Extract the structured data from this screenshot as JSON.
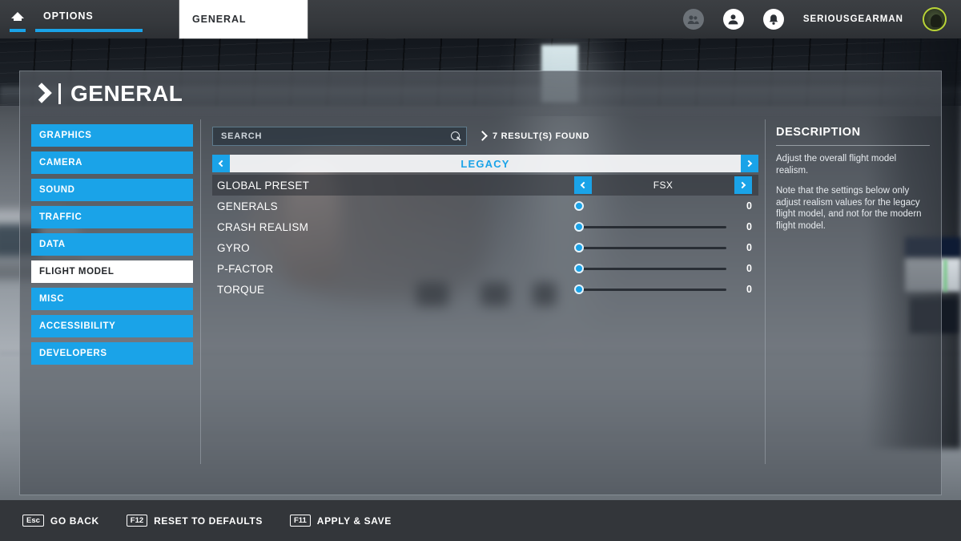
{
  "topbar": {
    "home_icon": "home-icon",
    "options_tab": "OPTIONS",
    "general_tab": "GENERAL",
    "friends_icon": "friends-icon",
    "profile_icon": "profile-icon",
    "notifications_icon": "bell-icon",
    "username": "SERIOUSGEARMAN",
    "avatar": "user-avatar"
  },
  "dialog": {
    "title": "GENERAL",
    "title_icon": "chevron-right-icon"
  },
  "sidebar": {
    "items": [
      {
        "label": "GRAPHICS",
        "active": false
      },
      {
        "label": "CAMERA",
        "active": false
      },
      {
        "label": "SOUND",
        "active": false
      },
      {
        "label": "TRAFFIC",
        "active": false
      },
      {
        "label": "DATA",
        "active": false
      },
      {
        "label": "FLIGHT MODEL",
        "active": true
      },
      {
        "label": "MISC",
        "active": false
      },
      {
        "label": "ACCESSIBILITY",
        "active": false
      },
      {
        "label": "DEVELOPERS",
        "active": false
      }
    ]
  },
  "search": {
    "placeholder": "SEARCH",
    "value": "",
    "icon": "search-icon",
    "results_text": "7 RESULT(S) FOUND",
    "results_chevron": "chevron-right-icon"
  },
  "category": {
    "title": "LEGACY",
    "prev_icon": "chevron-left-icon",
    "next_icon": "chevron-right-icon"
  },
  "settings": [
    {
      "label": "GLOBAL PRESET",
      "type": "dropdown",
      "value": "FSX",
      "banded": true
    },
    {
      "label": "GENERALS",
      "type": "slider",
      "value": "0",
      "percent": 0,
      "hover": true
    },
    {
      "label": "CRASH REALISM",
      "type": "slider",
      "value": "0",
      "percent": 0,
      "hover": false
    },
    {
      "label": "GYRO",
      "type": "slider",
      "value": "0",
      "percent": 0,
      "hover": false
    },
    {
      "label": "P-FACTOR",
      "type": "slider",
      "value": "0",
      "percent": 0,
      "hover": false
    },
    {
      "label": "TORQUE",
      "type": "slider",
      "value": "0",
      "percent": 0,
      "hover": false
    }
  ],
  "description": {
    "title": "DESCRIPTION",
    "paragraph1": "Adjust the overall flight model realism.",
    "paragraph2": "Note that the settings below only adjust realism values for the legacy flight model, and not for the modern flight model."
  },
  "footer": {
    "actions": [
      {
        "key": "Esc",
        "label": "GO BACK"
      },
      {
        "key": "F12",
        "label": "RESET TO DEFAULTS"
      },
      {
        "key": "F11",
        "label": "APPLY & SAVE"
      }
    ]
  },
  "colors": {
    "accent_blue": "#1aa3e8",
    "panel_dark": "#33363a",
    "text_white": "#ffffff"
  }
}
